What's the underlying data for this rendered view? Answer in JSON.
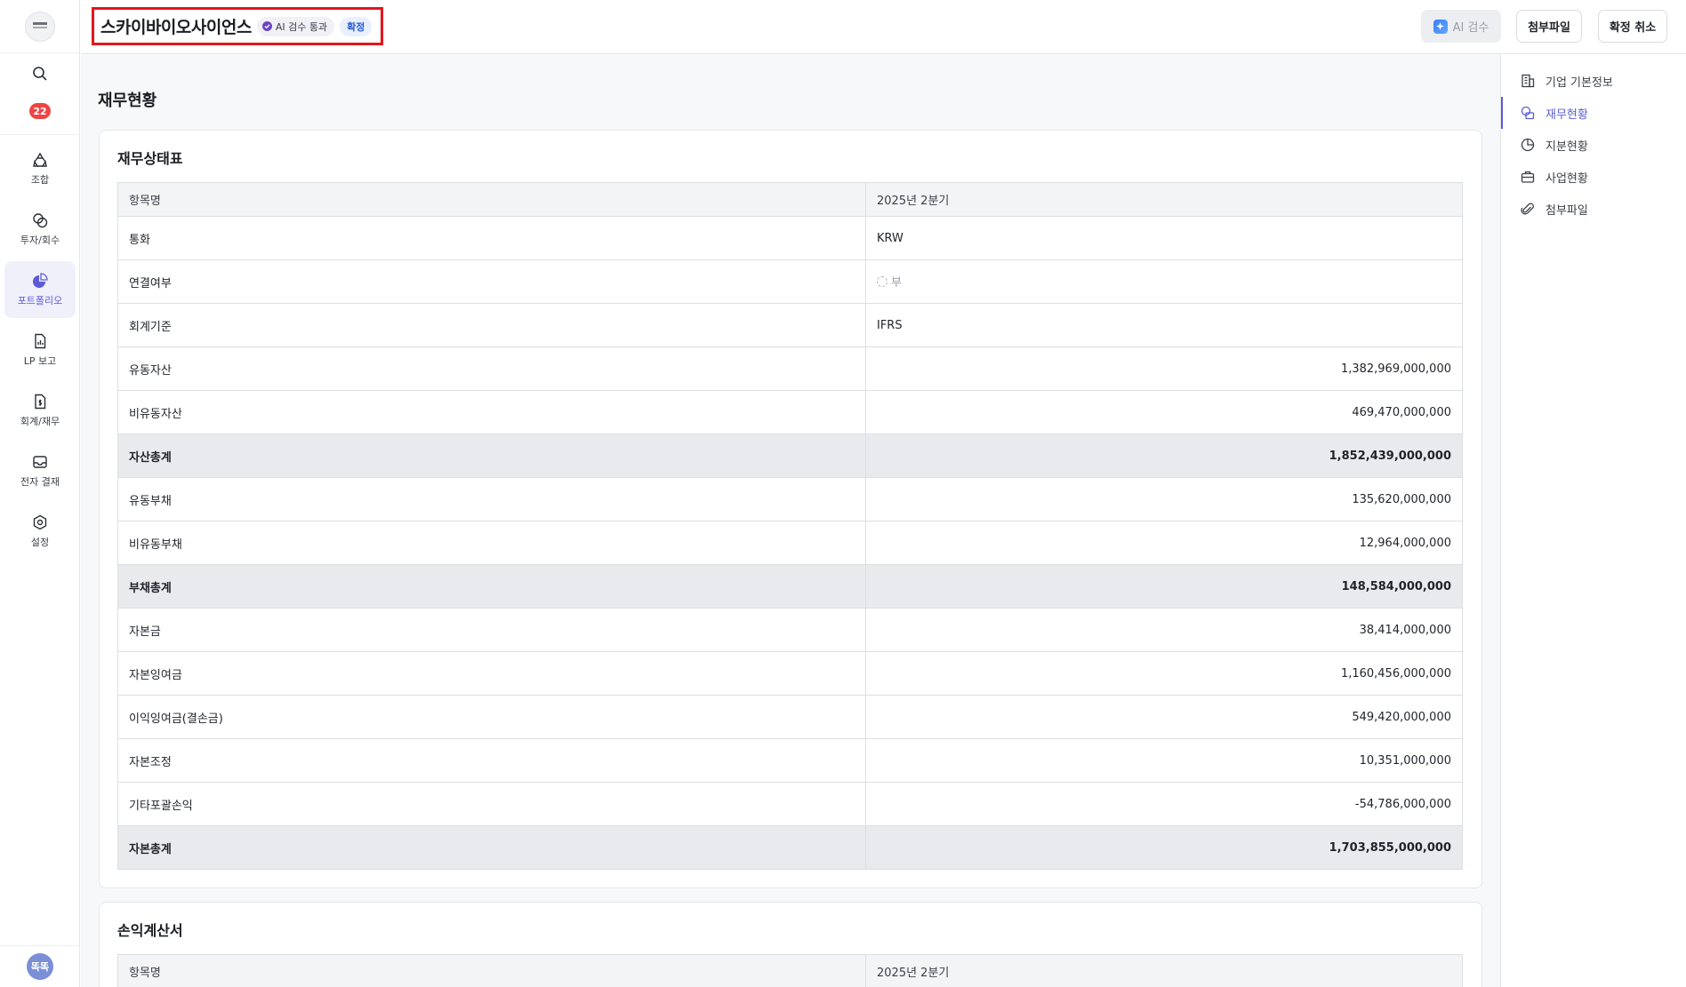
{
  "sidebar": {
    "notification_count": "22",
    "items": [
      {
        "label": "조합",
        "icon": "recycle-icon"
      },
      {
        "label": "투자/회수",
        "icon": "coins-icon"
      },
      {
        "label": "포트폴리오",
        "icon": "pie-chart-icon",
        "active": true
      },
      {
        "label": "LP 보고",
        "icon": "report-icon"
      },
      {
        "label": "회계/재무",
        "icon": "accounting-icon"
      },
      {
        "label": "전자 결재",
        "icon": "inbox-icon"
      },
      {
        "label": "설정",
        "icon": "gear-icon"
      }
    ],
    "avatar_text": "똑똑"
  },
  "header": {
    "company_name": "스카이바이오사이언스",
    "ai_badge": "AI 검수 통과",
    "status_badge": "확정",
    "ai_button": "AI 검수",
    "attach_button": "첨부파일",
    "cancel_button": "확정 취소"
  },
  "main": {
    "section_title": "재무현황",
    "balance_sheet": {
      "title": "재무상태표",
      "col_item": "항목명",
      "col_period": "2025년 2분기",
      "rows": [
        {
          "label": "통화",
          "value": "KRW",
          "align": "left"
        },
        {
          "label": "연결여부",
          "value": "부",
          "align": "left",
          "pending": true
        },
        {
          "label": "회계기준",
          "value": "IFRS",
          "align": "left"
        },
        {
          "label": "유동자산",
          "value": "1,382,969,000,000"
        },
        {
          "label": "비유동자산",
          "value": "469,470,000,000"
        },
        {
          "label": "자산총계",
          "value": "1,852,439,000,000",
          "total": true
        },
        {
          "label": "유동부채",
          "value": "135,620,000,000"
        },
        {
          "label": "비유동부채",
          "value": "12,964,000,000"
        },
        {
          "label": "부채총계",
          "value": "148,584,000,000",
          "total": true
        },
        {
          "label": "자본금",
          "value": "38,414,000,000"
        },
        {
          "label": "자본잉여금",
          "value": "1,160,456,000,000"
        },
        {
          "label": "이익잉여금(결손금)",
          "value": "549,420,000,000"
        },
        {
          "label": "자본조정",
          "value": "10,351,000,000"
        },
        {
          "label": "기타포괄손익",
          "value": "-54,786,000,000"
        },
        {
          "label": "자본총계",
          "value": "1,703,855,000,000",
          "total": true
        }
      ]
    },
    "income_statement": {
      "title": "손익계산서",
      "col_item": "항목명",
      "col_period": "2025년 2분기"
    }
  },
  "toc": {
    "items": [
      {
        "label": "기업 기본정보",
        "icon": "building-icon"
      },
      {
        "label": "재무현황",
        "icon": "finance-icon",
        "active": true
      },
      {
        "label": "지분현황",
        "icon": "pie-chart-icon"
      },
      {
        "label": "사업현황",
        "icon": "briefcase-icon"
      },
      {
        "label": "첨부파일",
        "icon": "paperclip-icon"
      }
    ]
  }
}
